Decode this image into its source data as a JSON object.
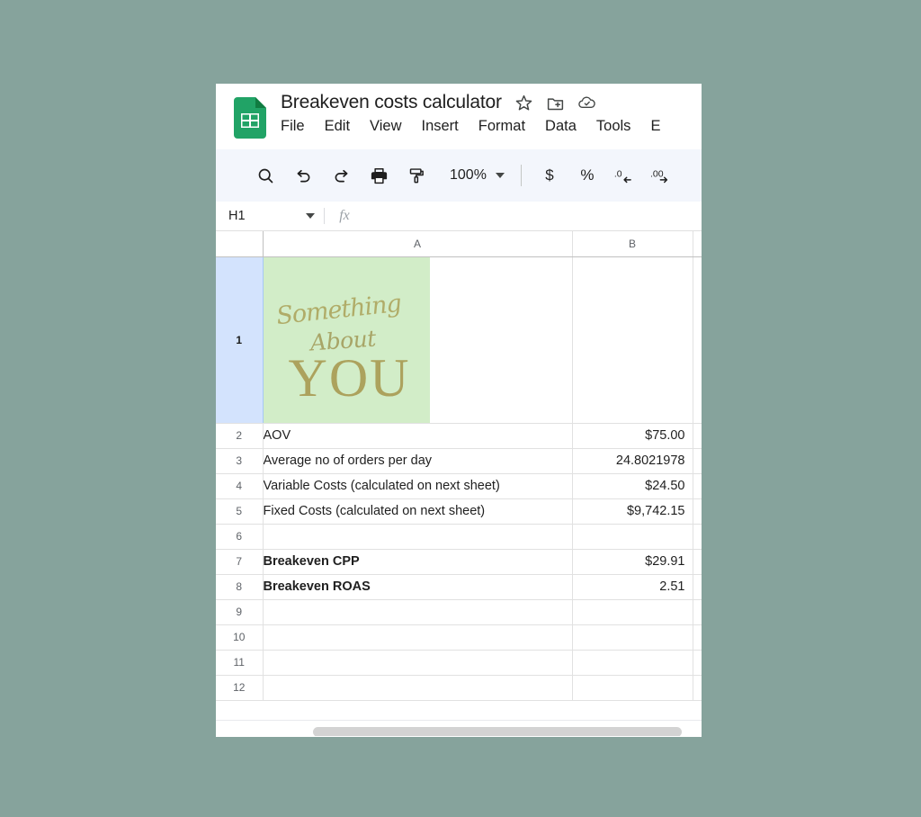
{
  "app": {
    "doc_title": "Breakeven costs calculator",
    "doc_icon": "sheets-icon",
    "title_actions": [
      {
        "name": "star-icon",
        "label": "Star"
      },
      {
        "name": "move-to-folder-icon",
        "label": "Move"
      },
      {
        "name": "cloud-saved-icon",
        "label": "Saved to Drive"
      }
    ],
    "menus": [
      "File",
      "Edit",
      "View",
      "Insert",
      "Format",
      "Data",
      "Tools",
      "E"
    ]
  },
  "toolbar": {
    "search_label": "Search",
    "undo_label": "Undo",
    "redo_label": "Redo",
    "print_label": "Print",
    "paint_format_label": "Paint format",
    "zoom_value": "100%",
    "currency_label": "$",
    "percent_label": "%",
    "decrease_decimal_label": ".0",
    "increase_decimal_label": ".00"
  },
  "formula_bar": {
    "name_box_value": "H1",
    "fx_label": "fx",
    "formula_value": ""
  },
  "grid": {
    "column_headers": [
      "A",
      "B"
    ],
    "active_row": "1",
    "rows": [
      {
        "num": "1",
        "a": "",
        "b": "",
        "bold": false,
        "logo": true
      },
      {
        "num": "2",
        "a": "AOV",
        "b": "$75.00",
        "bold": false,
        "logo": false
      },
      {
        "num": "3",
        "a": "Average no of orders per day",
        "b": "24.8021978",
        "bold": false,
        "logo": false
      },
      {
        "num": "4",
        "a": "Variable Costs (calculated on next sheet)",
        "b": "$24.50",
        "bold": false,
        "logo": false
      },
      {
        "num": "5",
        "a": "Fixed Costs (calculated on next sheet)",
        "b": "$9,742.15",
        "bold": false,
        "logo": false
      },
      {
        "num": "6",
        "a": "",
        "b": "",
        "bold": false,
        "logo": false
      },
      {
        "num": "7",
        "a": "Breakeven CPP",
        "b": "$29.91",
        "bold": true,
        "logo": false
      },
      {
        "num": "8",
        "a": "Breakeven ROAS",
        "b": "2.51",
        "bold": true,
        "logo": false
      },
      {
        "num": "9",
        "a": "",
        "b": "",
        "bold": false,
        "logo": false
      },
      {
        "num": "10",
        "a": "",
        "b": "",
        "bold": false,
        "logo": false
      },
      {
        "num": "11",
        "a": "",
        "b": "",
        "bold": false,
        "logo": false
      },
      {
        "num": "12",
        "a": "",
        "b": "",
        "bold": false,
        "logo": false
      }
    ]
  },
  "logo": {
    "line1": "Something",
    "line2": "About",
    "line3": "YOU",
    "background_color": "#d2edc8",
    "text_color": "#a89a52"
  },
  "colors": {
    "page_background": "#86a39c",
    "toolbar_background": "#f3f6fc",
    "active_row_header": "#d3e3fd",
    "sheets_green": "#0f9d58"
  }
}
